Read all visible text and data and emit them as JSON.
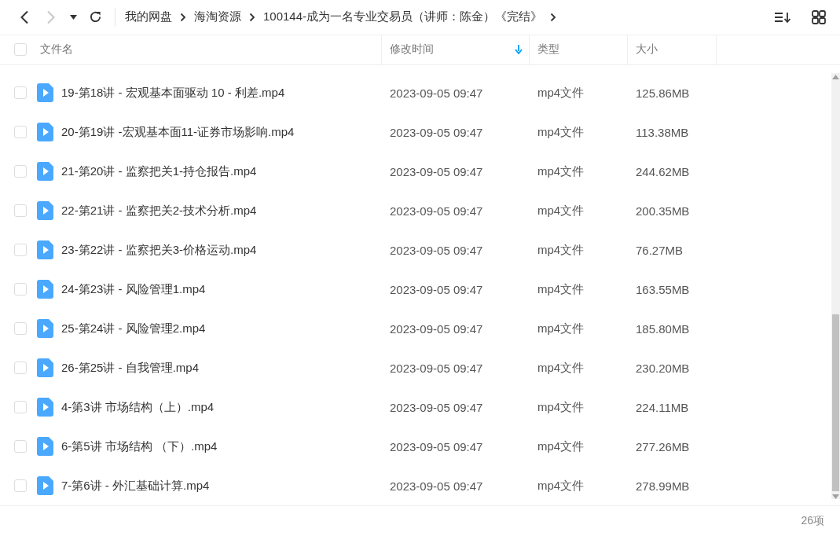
{
  "toolbar": {
    "back": {
      "disabled": false
    },
    "forward": {
      "disabled": true
    },
    "breadcrumb": [
      {
        "label": "我的网盘"
      },
      {
        "label": "海淘资源"
      },
      {
        "label": "100144-成为一名专业交易员（讲师：陈金）《完结》"
      }
    ]
  },
  "table": {
    "select_all": {
      "checked": false
    },
    "columns": [
      {
        "label": "文件名",
        "sorted": false
      },
      {
        "label": "修改时间",
        "sorted": true
      },
      {
        "label": "类型",
        "sorted": false
      },
      {
        "label": "大小",
        "sorted": false
      }
    ],
    "rows": [
      {
        "name": "19-第18讲 - 宏观基本面驱动 10 - 利差.mp4",
        "modified": "2023-09-05 09:47",
        "type": "mp4文件",
        "size": "125.86MB",
        "checked": false
      },
      {
        "name": "20-第19讲 -宏观基本面11-证券市场影响.mp4",
        "modified": "2023-09-05 09:47",
        "type": "mp4文件",
        "size": "113.38MB",
        "checked": false
      },
      {
        "name": "21-第20讲 - 监察把关1-持仓报告.mp4",
        "modified": "2023-09-05 09:47",
        "type": "mp4文件",
        "size": "244.62MB",
        "checked": false
      },
      {
        "name": "22-第21讲 - 监察把关2-技术分析.mp4",
        "modified": "2023-09-05 09:47",
        "type": "mp4文件",
        "size": "200.35MB",
        "checked": false
      },
      {
        "name": "23-第22讲 - 监察把关3-价格运动.mp4",
        "modified": "2023-09-05 09:47",
        "type": "mp4文件",
        "size": "76.27MB",
        "checked": false
      },
      {
        "name": "24-第23讲 - 风险管理1.mp4",
        "modified": "2023-09-05 09:47",
        "type": "mp4文件",
        "size": "163.55MB",
        "checked": false
      },
      {
        "name": "25-第24讲 - 风险管理2.mp4",
        "modified": "2023-09-05 09:47",
        "type": "mp4文件",
        "size": "185.80MB",
        "checked": false
      },
      {
        "name": "26-第25讲 - 自我管理.mp4",
        "modified": "2023-09-05 09:47",
        "type": "mp4文件",
        "size": "230.20MB",
        "checked": false
      },
      {
        "name": "4-第3讲  市场结构（上）.mp4",
        "modified": "2023-09-05 09:47",
        "type": "mp4文件",
        "size": "224.11MB",
        "checked": false
      },
      {
        "name": "6-第5讲 市场结构  （下）.mp4",
        "modified": "2023-09-05 09:47",
        "type": "mp4文件",
        "size": "277.26MB",
        "checked": false
      },
      {
        "name": "7-第6讲 - 外汇基础计算.mp4",
        "modified": "2023-09-05 09:47",
        "type": "mp4文件",
        "size": "278.99MB",
        "checked": false
      }
    ]
  },
  "status_bar": {
    "count": "26项"
  }
}
